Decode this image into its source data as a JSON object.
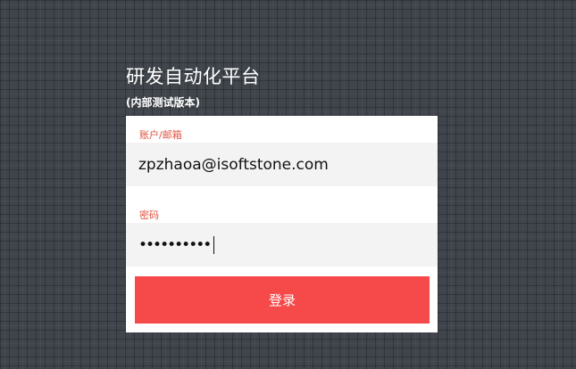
{
  "header": {
    "title": "研发自动化平台",
    "subtitle": "(内部测试版本)"
  },
  "form": {
    "account_label": "账户/邮箱",
    "account_value": "zpzhaoa@isoftstone.com",
    "password_label": "密码",
    "password_mask": "••••••••••",
    "login_label": "登录"
  },
  "colors": {
    "label_accent": "#e0523f",
    "button_bg": "#f64a4a",
    "page_bg": "#40454c"
  }
}
